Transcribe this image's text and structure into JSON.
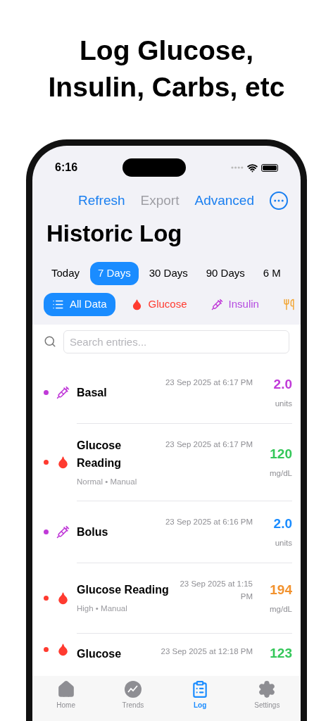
{
  "headline": [
    "Log Glucose,",
    "Insulin, Carbs, etc"
  ],
  "status_bar": {
    "time": "6:16"
  },
  "toolbar": [
    {
      "label": "Refresh",
      "disabled": false
    },
    {
      "label": "Export",
      "disabled": true
    },
    {
      "label": "Advanced",
      "disabled": false
    }
  ],
  "title": "Historic Log",
  "periods": [
    {
      "label": "Today",
      "selected": false
    },
    {
      "label": "7 Days",
      "selected": true
    },
    {
      "label": "30 Days",
      "selected": false
    },
    {
      "label": "90 Days",
      "selected": false
    },
    {
      "label": "6 M",
      "selected": false
    }
  ],
  "filters": [
    {
      "kind": "all",
      "label": "All Data",
      "selected": true
    },
    {
      "kind": "glucose",
      "label": "Glucose",
      "selected": false
    },
    {
      "kind": "insulin",
      "label": "Insulin",
      "selected": false
    },
    {
      "kind": "carbs",
      "selected": false
    }
  ],
  "search": {
    "placeholder": "Search entries..."
  },
  "entries": [
    {
      "kind": "insulin",
      "title": "Basal",
      "date": "23 Sep 2025 at 6:17 PM",
      "value": "2.0",
      "unit": "units",
      "color": "#c03ad8"
    },
    {
      "kind": "glucose",
      "title": "Glucose Reading",
      "date": "23 Sep 2025 at 6:17 PM",
      "value": "120",
      "unit": "mg/dL",
      "color": "#34c759",
      "detail": "Normal • Manual",
      "narrow": true
    },
    {
      "kind": "insulin",
      "title": "Bolus",
      "date": "23 Sep 2025 at 6:16 PM",
      "value": "2.0",
      "unit": "units",
      "color": "#1a8cff"
    },
    {
      "kind": "glucose",
      "title": "Glucose Reading",
      "date": "23 Sep 2025 at 1:15 PM",
      "value": "194",
      "unit": "mg/dL",
      "color": "#f2922e",
      "detail": "High • Manual"
    },
    {
      "kind": "glucose",
      "title": "Glucose",
      "date": "23 Sep 2025 at 12:18 PM",
      "value": "123",
      "color": "#34c759"
    }
  ],
  "tab_bar": [
    {
      "kind": "home",
      "label": "Home",
      "selected": false
    },
    {
      "kind": "trends",
      "label": "Trends",
      "selected": false
    },
    {
      "kind": "log",
      "label": "Log",
      "selected": true
    },
    {
      "kind": "settings",
      "label": "Settings",
      "selected": false
    }
  ]
}
